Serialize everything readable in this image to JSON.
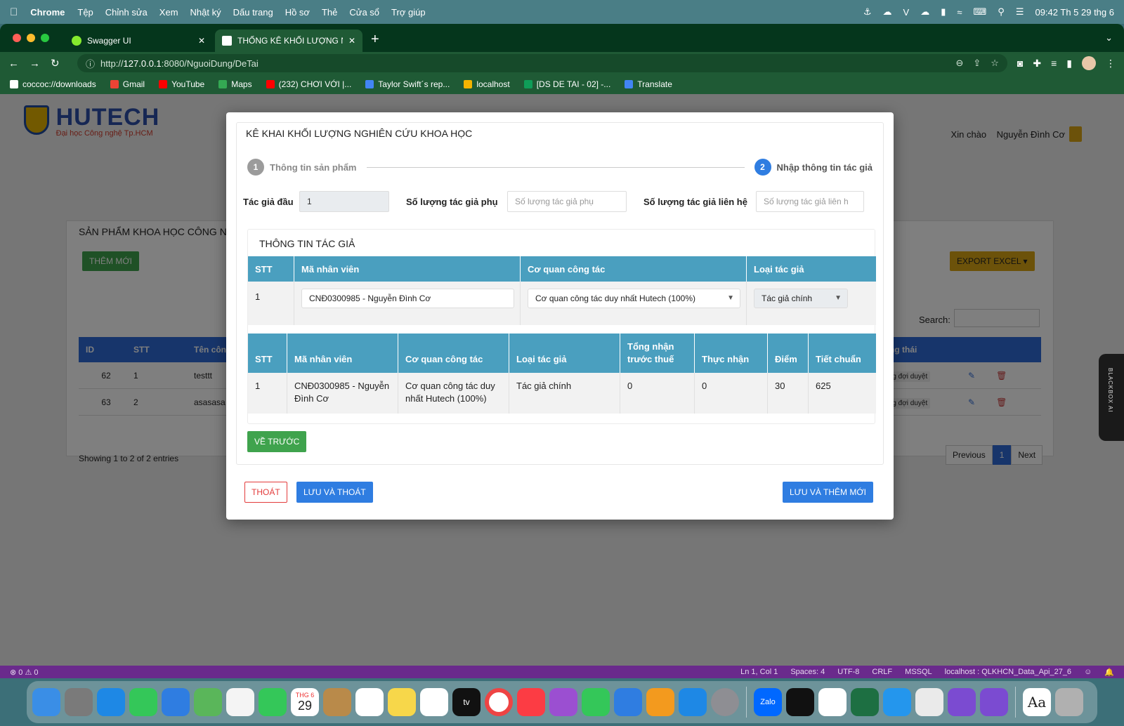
{
  "menubar": {
    "app": "Chrome",
    "items": [
      "Tệp",
      "Chỉnh sửa",
      "Xem",
      "Nhật ký",
      "Dấu trang",
      "Hồ sơ",
      "Thẻ",
      "Cửa sổ",
      "Trợ giúp"
    ],
    "clock": "09:42 Th 5 29 thg 6",
    "v_label": "V"
  },
  "browser": {
    "tabs": [
      {
        "label": "Swagger UI"
      },
      {
        "label": "THỐNG KÊ KHỐI LƯỢNG NCKH"
      }
    ],
    "url_scheme": "http://",
    "url_host": "127.0.0.1",
    "url_rest": ":8080/NguoiDung/DeTai",
    "bookmarks": [
      {
        "label": "coccoc://downloads",
        "color": "#ffffff"
      },
      {
        "label": "Gmail",
        "color": "#ea4335"
      },
      {
        "label": "YouTube",
        "color": "#ff0000"
      },
      {
        "label": "Maps",
        "color": "#34a853"
      },
      {
        "label": "(232) CHƠI VỚI |...",
        "color": "#ff0000"
      },
      {
        "label": "Taylor Swift´s rep...",
        "color": "#4285f4"
      },
      {
        "label": "localhost",
        "color": "#f4b400"
      },
      {
        "label": "[DS DE TAI - 02] -...",
        "color": "#0f9d58"
      },
      {
        "label": "Translate",
        "color": "#4285f4"
      }
    ]
  },
  "page": {
    "logo_big": "HUTECH",
    "logo_small": "Đại học Công nghệ Tp.HCM",
    "greet_label": "Xin chào",
    "user_name": "Nguyễn Đình Cơ",
    "card_title": "SẢN PHẨM KHOA HỌC CÔNG NG",
    "btn_new": "THÊM MỚI",
    "btn_export": "EXPORT EXCEL",
    "search_label": "Search:",
    "columns": [
      "ID",
      "STT",
      "Tên côn",
      "Trạng thái"
    ],
    "rows": [
      {
        "id": "62",
        "stt": "1",
        "name": "testtt",
        "status": "Đang đợi duyệt"
      },
      {
        "id": "63",
        "stt": "2",
        "name": "asasasa",
        "status": "Đang đợi duyệt"
      }
    ],
    "showing": "Showing 1 to 2 of 2 entries",
    "pager": {
      "prev": "Previous",
      "current": "1",
      "next": "Next"
    }
  },
  "modal": {
    "title": "KÊ KHAI KHỐI LƯỢNG NGHIÊN CỨU KHOA HỌC",
    "step1_num": "1",
    "step1_label": "Thông tin sản phẩm",
    "step2_num": "2",
    "step2_label": "Nhập thông tin tác giả",
    "lead_author_label": "Tác giả đầu",
    "lead_author_value": "1",
    "sub_count_label": "Số lượng tác giả phụ",
    "sub_count_placeholder": "Số lượng tác giả phụ",
    "contact_count_label": "Số lượng tác giả liên hệ",
    "contact_count_placeholder": "Số lượng tác giả liên h",
    "author_card_title": "THÔNG TIN TÁC GIẢ",
    "form_table": {
      "headers": [
        "STT",
        "Mã nhân viên",
        "Cơ quan công tác",
        "Loại tác giả"
      ],
      "stt": "1",
      "employee_value": "CNĐ0300985 - Nguyễn Đình Cơ",
      "agency_value": "Cơ quan công tác duy nhất Hutech (100%)",
      "author_type_value": "Tác giả chính"
    },
    "summary_table": {
      "headers": [
        "STT",
        "Mã nhân viên",
        "Cơ quan công tác",
        "Loại tác giả",
        "Tổng nhận trước thuế",
        "Thực nhận",
        "Điểm",
        "Tiết chuẩn"
      ],
      "row": [
        "1",
        "CNĐ0300985 - Nguyễn Đình Cơ",
        "Cơ quan công tác duy nhất Hutech (100%)",
        "Tác giả chính",
        "0",
        "0",
        "30",
        "625"
      ]
    },
    "btn_back": "VỀ TRƯỚC",
    "btn_exit": "THOÁT",
    "btn_save_exit": "LƯU VÀ THOÁT",
    "btn_save_new": "LƯU VÀ THÊM MỚI"
  },
  "side_widget": "BLACKBOX AI",
  "statusbar": {
    "problems": "⊗ 0 ⚠ 0",
    "position": "Ln 1, Col 1",
    "spaces": "Spaces: 4",
    "encoding": "UTF-8",
    "eol": "CRLF",
    "lang": "MSSQL",
    "connection": "localhost : QLKHCN_Data_Api_27_6"
  },
  "dock": {
    "calendar_month": "THG 6",
    "calendar_day": "29",
    "zalo_label": "Zalo",
    "tv_label": "tv",
    "dict_label": "Aa"
  },
  "colors": {
    "primary": "#2f7de1",
    "success": "#3fa34d",
    "danger": "#e33b3b",
    "table_header": "#4a9fbf",
    "warning": "#d9a514"
  }
}
